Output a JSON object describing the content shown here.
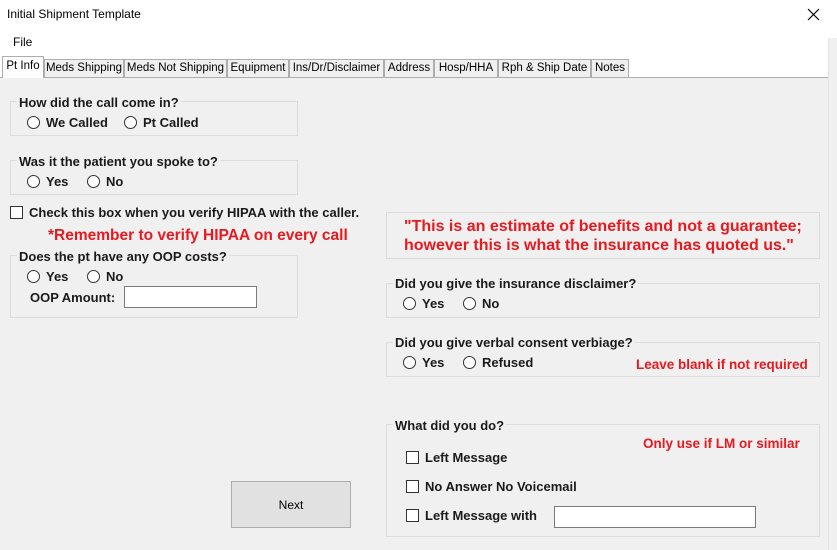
{
  "window": {
    "title": "Initial Shipment Template",
    "close_icon": "close-icon"
  },
  "menu": {
    "file": "File"
  },
  "tabs": [
    {
      "label": "Pt Info",
      "active": true
    },
    {
      "label": "Meds Shipping"
    },
    {
      "label": "Meds Not Shipping"
    },
    {
      "label": "Equipment"
    },
    {
      "label": "Ins/Dr/Disclaimer"
    },
    {
      "label": "Address"
    },
    {
      "label": "Hosp/HHA"
    },
    {
      "label": "Rph & Ship Date"
    },
    {
      "label": "Notes"
    }
  ],
  "call": {
    "question": "How did the call come in?",
    "options": [
      "We Called",
      "Pt Called"
    ]
  },
  "spoke": {
    "question": "Was it the patient you spoke to?",
    "options": [
      "Yes",
      "No"
    ]
  },
  "hipaa": {
    "checkbox_label": "Check this box when you verify HIPAA with the caller.",
    "reminder": "*Remember to verify HIPAA on every call"
  },
  "oop": {
    "question": "Does the pt have any OOP costs?",
    "options": [
      "Yes",
      "No"
    ],
    "amount_label": "OOP Amount:",
    "amount_value": ""
  },
  "estimate": {
    "line1": "\"This is an estimate of benefits and not a guarantee;",
    "line2": "however this is what the insurance has quoted us.\""
  },
  "disclaimer": {
    "question": "Did you give the insurance disclaimer?",
    "options": [
      "Yes",
      "No"
    ]
  },
  "consent": {
    "question": "Did you give verbal consent verbiage?",
    "options": [
      "Yes",
      "Refused"
    ],
    "note": "Leave blank if not required"
  },
  "what_did": {
    "question": "What did you do?",
    "note": "Only use if LM or similar",
    "options": [
      "Left Message",
      "No Answer No Voicemail",
      "Left Message with"
    ],
    "left_with_value": ""
  },
  "buttons": {
    "next": "Next"
  },
  "colors": {
    "warning_red": "#e8191f",
    "panel_bg": "#f0f0f0"
  }
}
